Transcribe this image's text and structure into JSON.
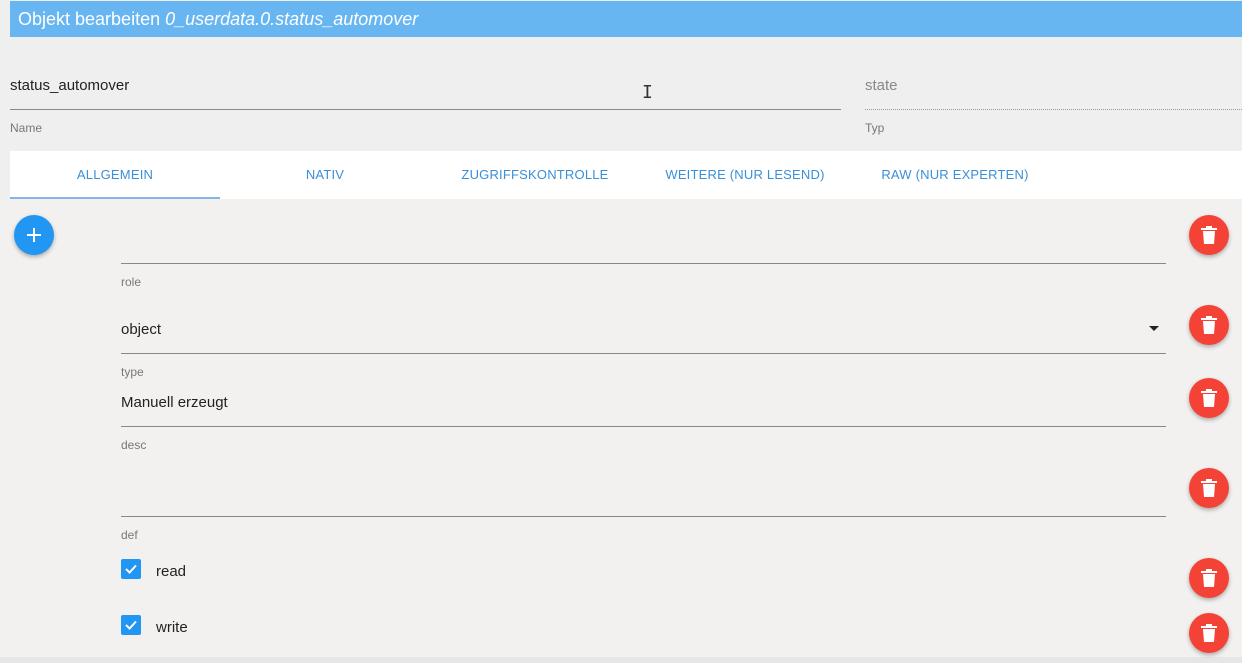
{
  "header": {
    "title_prefix": "Objekt bearbeiten ",
    "object_id": "0_userdata.0.status_automover"
  },
  "top_fields": {
    "name": {
      "value": "status_automover",
      "label": "Name"
    },
    "typ": {
      "value": "state",
      "label": "Typ"
    }
  },
  "tabs": [
    {
      "label": "ALLGEMEIN",
      "active": true
    },
    {
      "label": "NATIV",
      "active": false
    },
    {
      "label": "ZUGRIFFSKONTROLLE",
      "active": false
    },
    {
      "label": "WEITERE (NUR LESEND)",
      "active": false
    },
    {
      "label": "RAW (NUR EXPERTEN)",
      "active": false
    }
  ],
  "common": {
    "role": {
      "label": "role",
      "value": ""
    },
    "type": {
      "label": "type",
      "value": "object",
      "options": [
        "object"
      ]
    },
    "desc": {
      "label": "desc",
      "value": "Manuell erzeugt"
    },
    "def": {
      "label": "def",
      "value": ""
    },
    "read": {
      "label": "read",
      "checked": true
    },
    "write": {
      "label": "write",
      "checked": true
    }
  },
  "icons": {
    "add": "plus-icon",
    "delete": "trash-icon",
    "dropdown": "caret-down-icon",
    "check": "checkmark-icon",
    "cursor": "text-cursor-icon"
  },
  "colors": {
    "header_bg": "#67b5f1",
    "tab_text": "#3a8fd8",
    "fab_blue": "#2196f3",
    "delete_red": "#f44336",
    "checkbox_blue": "#2196f3"
  }
}
